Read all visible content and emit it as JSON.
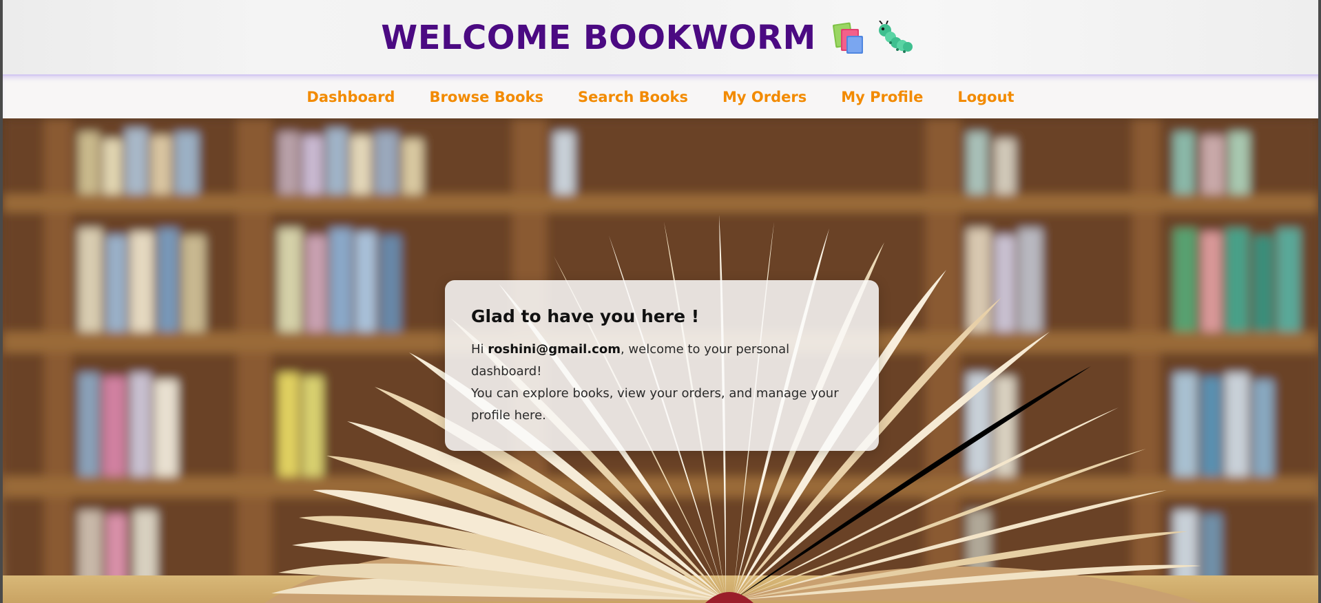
{
  "header": {
    "title": "WELCOME BOOKWORM",
    "icons": [
      "books-icon",
      "caterpillar-icon"
    ],
    "title_color": "#4b0a82"
  },
  "nav": {
    "link_color": "#f28a00",
    "items": [
      {
        "label": "Dashboard"
      },
      {
        "label": "Browse Books"
      },
      {
        "label": "Search Books"
      },
      {
        "label": "My Orders"
      },
      {
        "label": "My Profile"
      },
      {
        "label": "Logout"
      }
    ]
  },
  "card": {
    "heading": "Glad to have you here !",
    "greeting_prefix": "Hi ",
    "user_email": "roshini@gmail.com",
    "greeting_suffix": ", welcome to your personal dashboard!",
    "description": "You can explore books, view your orders, and manage your profile here."
  }
}
